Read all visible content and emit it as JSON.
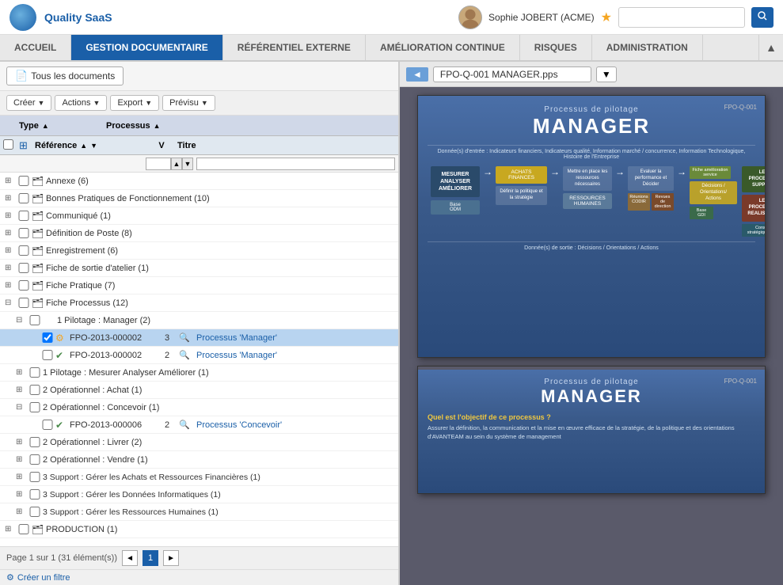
{
  "app": {
    "title": "Quality SaaS",
    "logo_alt": "Quality SaaS Logo"
  },
  "user": {
    "name": "Sophie JOBERT (ACME)",
    "avatar_char": "👤"
  },
  "search": {
    "placeholder": "",
    "btn_label": "🔍"
  },
  "nav": {
    "items": [
      {
        "label": "ACCUEIL",
        "active": false
      },
      {
        "label": "GESTION DOCUMENTAIRE",
        "active": true
      },
      {
        "label": "RÉFÉRENTIEL EXTERNE",
        "active": false
      },
      {
        "label": "AMÉLIORATION CONTINUE",
        "active": false
      },
      {
        "label": "RISQUES",
        "active": false
      },
      {
        "label": "ADMINISTRATION",
        "active": false
      }
    ]
  },
  "docs_tab": {
    "label": "Tous les documents"
  },
  "toolbar": {
    "create_label": "Créer",
    "actions_label": "Actions",
    "export_label": "Export",
    "preview_label": "Prévisu"
  },
  "table": {
    "col_type": "Type",
    "col_processus": "Processus",
    "col_reference": "Référence",
    "col_v": "V",
    "col_title": "Titre"
  },
  "tree_items": [
    {
      "indent": 0,
      "expand": "⊞",
      "label": "Annexe (6)",
      "type": "group"
    },
    {
      "indent": 0,
      "expand": "⊞",
      "label": "Bonnes Pratiques de Fonctionnement (10)",
      "type": "group"
    },
    {
      "indent": 0,
      "expand": "⊞",
      "label": "Communiqué (1)",
      "type": "group"
    },
    {
      "indent": 0,
      "expand": "⊞",
      "label": "Définition de Poste (8)",
      "type": "group"
    },
    {
      "indent": 0,
      "expand": "⊞",
      "label": "Enregistrement (6)",
      "type": "group"
    },
    {
      "indent": 0,
      "expand": "⊞",
      "label": "Fiche de sortie d'atelier (1)",
      "type": "group"
    },
    {
      "indent": 0,
      "expand": "⊞",
      "label": "Fiche Pratique (7)",
      "type": "group"
    },
    {
      "indent": 0,
      "expand": "⊟",
      "label": "Fiche Processus (12)",
      "type": "group"
    },
    {
      "indent": 1,
      "expand": "⊟",
      "label": "1 Pilotage : Manager (2)",
      "type": "subgroup"
    },
    {
      "indent": 2,
      "expand": "",
      "ref": "FPO-2013-000002",
      "version": "3",
      "label": "Processus 'Manager'",
      "type": "doc",
      "selected": true,
      "icon": "⚙️",
      "checked": true
    },
    {
      "indent": 2,
      "expand": "",
      "ref": "FPO-2013-000002",
      "version": "2",
      "label": "Processus 'Manager'",
      "type": "doc",
      "icon": "✅",
      "checked": false
    },
    {
      "indent": 1,
      "expand": "⊞",
      "label": "1 Pilotage : Mesurer Analyser Améliorer (1)",
      "type": "subgroup"
    },
    {
      "indent": 1,
      "expand": "⊞",
      "label": "2 Opérationnel : Achat (1)",
      "type": "subgroup"
    },
    {
      "indent": 1,
      "expand": "⊟",
      "label": "2 Opérationnel : Concevoir (1)",
      "type": "subgroup"
    },
    {
      "indent": 2,
      "expand": "",
      "ref": "FPO-2013-000006",
      "version": "2",
      "label": "Processus 'Concevoir'",
      "type": "doc",
      "icon": "✅",
      "checked": false
    },
    {
      "indent": 1,
      "expand": "⊞",
      "label": "2 Opérationnel : Livrer (2)",
      "type": "subgroup"
    },
    {
      "indent": 1,
      "expand": "⊞",
      "label": "2 Opérationnel : Vendre (1)",
      "type": "subgroup"
    },
    {
      "indent": 1,
      "expand": "⊞",
      "label": "3 Support : Gérer les Achats et Ressources Financières (1)",
      "type": "subgroup"
    },
    {
      "indent": 1,
      "expand": "⊞",
      "label": "3 Support : Gérer les Données Informatiques (1)",
      "type": "subgroup"
    },
    {
      "indent": 1,
      "expand": "⊞",
      "label": "3 Support : Gérer les Ressources Humaines (1)",
      "type": "subgroup"
    },
    {
      "indent": 0,
      "expand": "⊞",
      "label": "PRODUCTION (1)",
      "type": "group"
    }
  ],
  "pagination": {
    "info": "Page 1 sur 1 (31 élément(s))",
    "current": "1"
  },
  "filter": {
    "link_label": "Créer un filtre"
  },
  "preview": {
    "nav_btn_label": "◄",
    "filename": "FPO-Q-001 MANAGER.pps",
    "dropdown_label": "▼",
    "slide1": {
      "subtitle": "Processus de pilotage",
      "title": "MANAGER",
      "ref": "FPO-Q-001",
      "data_entry": "Donnée(s) d'entrée : Indicateurs financiers, Indicateurs qualité, Information marché / concurrence, Information Technologique, Histoire de l'Entreprise",
      "box_measure": "MESURER\nANALYSER\nAMÉLIORER",
      "box_achats": "ACHATS\nFINANCES",
      "box_define": "Définir la politique et\nla stratégie",
      "box_mettre": "Mettre en place les\nressources nécessaires",
      "box_evaluer": "Evaluer la\nperformance et\nDécider",
      "box_decisions": "Décisions /\nOrientations/\nActions",
      "box_support": "LES\nPROCESSUS\nSUPPORT",
      "box_realisation": "LES\nPROCESSUS\nREALISATION",
      "box_ressources": "RESSOURCES\nHUMAINES",
      "note1": "Fiche\namélioration\nservice",
      "reunions": "Réunions\nCODIR",
      "revues": "Revues de\ndirection",
      "base_gdi": "Base\nGDI",
      "base_odm": "Base\nODM",
      "conseils": "Conseils\nstratégiques\nenv.",
      "data_exit": "Donnée(s) de sortie : Décisions / Orientations / Actions"
    },
    "slide2": {
      "subtitle": "Processus de pilotage",
      "title": "MANAGER",
      "ref": "FPO-Q-001",
      "question": "Quel est l'objectif de ce processus ?",
      "answer": "Assurer la définition, la communication et la mise en œuvre efficace de la stratégie, de la politique et des orientations d'AVANTEAM au sein du système de management"
    }
  }
}
